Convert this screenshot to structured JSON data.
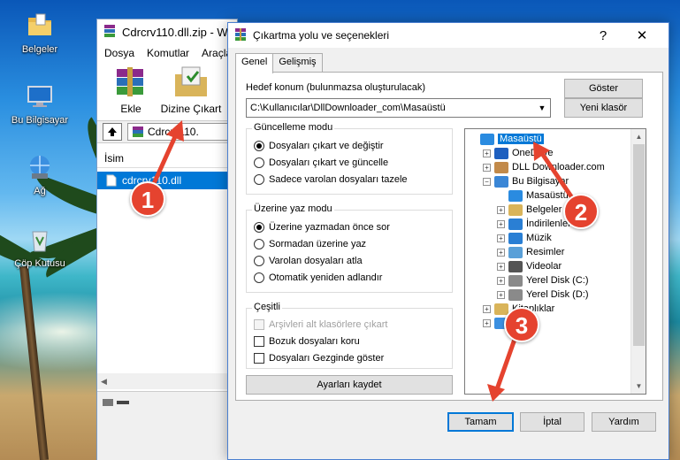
{
  "desktop": {
    "icons": [
      {
        "label": "Belgeler",
        "icon": "folder-documents-icon"
      },
      {
        "label": "Bu Bilgisayar",
        "icon": "computer-icon"
      },
      {
        "label": "Ağ",
        "icon": "network-icon"
      },
      {
        "label": "Çöp Kutusu",
        "icon": "recycle-bin-icon"
      }
    ]
  },
  "winrar": {
    "title": "Cdrcrv110.dll.zip - W",
    "menu": [
      "Dosya",
      "Komutlar",
      "Araçlar"
    ],
    "toolbar": {
      "add": "Ekle",
      "extract_to": "Dizine Çıkart"
    },
    "address": "Cdrcrv110.",
    "column_name": "İsim",
    "file": "cdrcrv110.dll"
  },
  "dialog": {
    "title": "Çıkartma yolu ve seçenekleri",
    "help_glyph": "?",
    "close_glyph": "✕",
    "tabs": [
      "Genel",
      "Gelişmiş"
    ],
    "dest_label": "Hedef konum (bulunmazsa oluşturulacak)",
    "dest_value": "C:\\Kullanıcılar\\DllDownloader_com\\Masaüstü",
    "show_button": "Göster",
    "new_folder_button": "Yeni klasör",
    "update_mode": {
      "title": "Güncelleme modu",
      "options": [
        "Dosyaları çıkart ve değiştir",
        "Dosyaları çıkart ve güncelle",
        "Sadece varolan dosyaları tazele"
      ],
      "selected": 0
    },
    "overwrite_mode": {
      "title": "Üzerine yaz modu",
      "options": [
        "Üzerine yazmadan önce sor",
        "Sormadan üzerine yaz",
        "Varolan dosyaları atla",
        "Otomatik yeniden adlandır"
      ],
      "selected": 0
    },
    "misc": {
      "title": "Çeşitli",
      "options": [
        {
          "label": "Arşivleri alt klasörlere çıkart",
          "checked": false,
          "disabled": true
        },
        {
          "label": "Bozuk dosyaları koru",
          "checked": false,
          "disabled": false
        },
        {
          "label": "Dosyaları Gezginde göster",
          "checked": false,
          "disabled": false
        }
      ]
    },
    "save_settings_button": "Ayarları kaydet",
    "tree": [
      {
        "label": "Masaüstü",
        "level": 0,
        "selected": true,
        "expander": "",
        "icon": "desktop-icon"
      },
      {
        "label": "OneDrive",
        "level": 1,
        "selected": false,
        "expander": "+",
        "icon": "onedrive-icon"
      },
      {
        "label": "DLL Downloader.com",
        "level": 1,
        "selected": false,
        "expander": "+",
        "icon": "user-icon"
      },
      {
        "label": "Bu Bilgisayar",
        "level": 1,
        "selected": false,
        "expander": "−",
        "icon": "computer-icon"
      },
      {
        "label": "Masaüstü",
        "level": 2,
        "selected": false,
        "expander": "",
        "icon": "desktop-icon"
      },
      {
        "label": "Belgeler",
        "level": 2,
        "selected": false,
        "expander": "+",
        "icon": "documents-icon"
      },
      {
        "label": "İndirilenler",
        "level": 2,
        "selected": false,
        "expander": "+",
        "icon": "downloads-icon"
      },
      {
        "label": "Müzik",
        "level": 2,
        "selected": false,
        "expander": "+",
        "icon": "music-icon"
      },
      {
        "label": "Resimler",
        "level": 2,
        "selected": false,
        "expander": "+",
        "icon": "pictures-icon"
      },
      {
        "label": "Videolar",
        "level": 2,
        "selected": false,
        "expander": "+",
        "icon": "videos-icon"
      },
      {
        "label": "Yerel Disk (C:)",
        "level": 2,
        "selected": false,
        "expander": "+",
        "icon": "drive-icon"
      },
      {
        "label": "Yerel Disk (D:)",
        "level": 2,
        "selected": false,
        "expander": "+",
        "icon": "drive-icon"
      },
      {
        "label": "Kitaplıklar",
        "level": 1,
        "selected": false,
        "expander": "+",
        "icon": "libraries-icon"
      },
      {
        "label": "Ağ",
        "level": 1,
        "selected": false,
        "expander": "+",
        "icon": "network-icon"
      }
    ],
    "ok_button": "Tamam",
    "cancel_button": "İptal",
    "help_button": "Yardım"
  },
  "annotations": {
    "step1": "1",
    "step2": "2",
    "step3": "3",
    "badge_color": "#e5432f"
  }
}
